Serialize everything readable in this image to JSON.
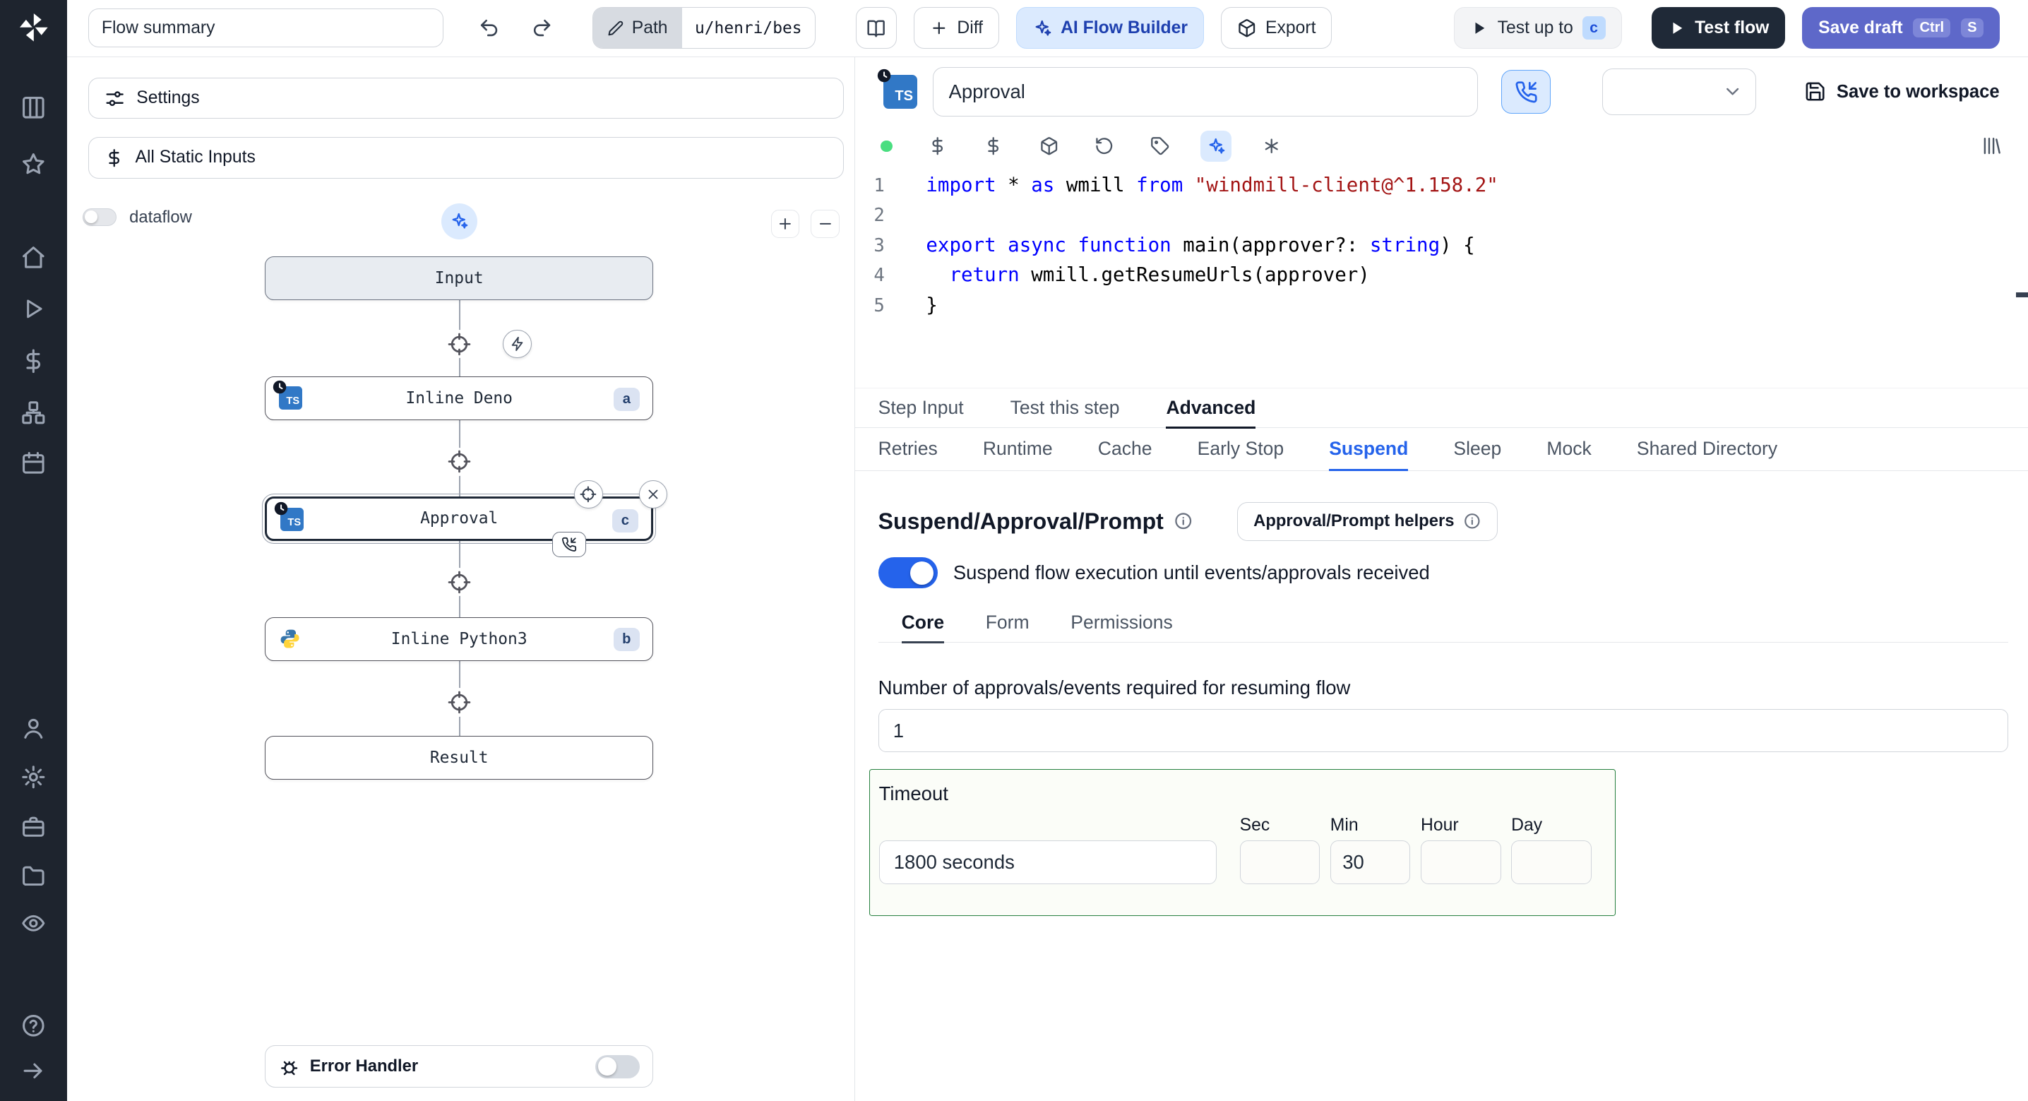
{
  "colors": {
    "sidebar_bg": "#1e242e",
    "accent_blue": "#2563eb",
    "ai_chip_bg": "#dbeafe",
    "test_flow_bg": "#1f2937",
    "save_draft_bg": "#5e68c9",
    "ts_icon_bg": "#3178c6",
    "timeout_border": "#26803f",
    "status_dot": "#4ade80",
    "code_keyword": "#0000ff",
    "code_string": "#a31515",
    "code_plain": "#000000"
  },
  "topbar": {
    "flow_summary_value": "Flow summary",
    "path_label": "Path",
    "path_value": "u/henri/bes",
    "diff_label": "Diff",
    "ai_builder_label": "AI Flow Builder",
    "export_label": "Export",
    "test_up_to_label": "Test up to",
    "test_up_to_badge": "c",
    "test_flow_label": "Test flow",
    "save_draft_label": "Save draft",
    "save_draft_keys": {
      "mod": "Ctrl",
      "key": "S"
    }
  },
  "sidebar": {
    "icons": [
      "windmill-logo",
      "kanban-board",
      "star",
      "home",
      "runs-play",
      "variables-dollar",
      "resources-boxes",
      "schedules-calendar",
      "user",
      "settings-gear",
      "workers-briefcase",
      "folders",
      "audit-eye",
      "help-circle",
      "collapse-arrow"
    ]
  },
  "flow": {
    "settings_label": "Settings",
    "static_inputs_label": "All Static Inputs",
    "dataflow_label": "dataflow",
    "nodes": {
      "input": "Input",
      "deno": {
        "label": "Inline Deno",
        "badge": "a"
      },
      "approval": {
        "label": "Approval",
        "badge": "c"
      },
      "python": {
        "label": "Inline Python3",
        "badge": "b"
      },
      "result": "Result"
    },
    "error_handler_label": "Error Handler"
  },
  "step": {
    "name_value": "Approval",
    "ts_icon_text": "TS",
    "save_to_workspace_label": "Save to workspace"
  },
  "editor": {
    "line_numbers": [
      1,
      2,
      3,
      4,
      5
    ],
    "lines": [
      [
        {
          "t": "import",
          "c": "kw"
        },
        {
          "t": " * ",
          "c": "pl"
        },
        {
          "t": "as",
          "c": "kw"
        },
        {
          "t": " wmill ",
          "c": "pl"
        },
        {
          "t": "from",
          "c": "kw"
        },
        {
          "t": " ",
          "c": "pl"
        },
        {
          "t": "\"windmill-client@^1.158.2\"",
          "c": "str"
        }
      ],
      [],
      [
        {
          "t": "export",
          "c": "kw"
        },
        {
          "t": " ",
          "c": "pl"
        },
        {
          "t": "async",
          "c": "kw"
        },
        {
          "t": " ",
          "c": "pl"
        },
        {
          "t": "function",
          "c": "kw"
        },
        {
          "t": " main(approver?: ",
          "c": "pl"
        },
        {
          "t": "string",
          "c": "kw"
        },
        {
          "t": ") {",
          "c": "pl"
        }
      ],
      [
        {
          "t": "  ",
          "c": "pl"
        },
        {
          "t": "return",
          "c": "kw"
        },
        {
          "t": " wmill.getResumeUrls(approver)",
          "c": "pl"
        }
      ],
      [
        {
          "t": "}",
          "c": "pl"
        }
      ]
    ]
  },
  "tabs": {
    "primary": [
      {
        "label": "Step Input",
        "active": false
      },
      {
        "label": "Test this step",
        "active": false
      },
      {
        "label": "Advanced",
        "active": true
      }
    ],
    "advanced": [
      {
        "label": "Retries",
        "active": false
      },
      {
        "label": "Runtime",
        "active": false
      },
      {
        "label": "Cache",
        "active": false
      },
      {
        "label": "Early Stop",
        "active": false
      },
      {
        "label": "Suspend",
        "active": true
      },
      {
        "label": "Sleep",
        "active": false
      },
      {
        "label": "Mock",
        "active": false
      },
      {
        "label": "Shared Directory",
        "active": false
      }
    ]
  },
  "suspend": {
    "title": "Suspend/Approval/Prompt",
    "helpers_button_label": "Approval/Prompt helpers",
    "toggle_label": "Suspend flow execution until events/approvals received",
    "sub_tabs": [
      {
        "label": "Core",
        "active": true
      },
      {
        "label": "Form",
        "active": false
      },
      {
        "label": "Permissions",
        "active": false
      }
    ],
    "approvals_label": "Number of approvals/events required for resuming flow",
    "approvals_value": "1",
    "timeout": {
      "label": "Timeout",
      "value": "1800 seconds",
      "units": [
        {
          "label": "Sec",
          "value": ""
        },
        {
          "label": "Min",
          "value": "30"
        },
        {
          "label": "Hour",
          "value": ""
        },
        {
          "label": "Day",
          "value": ""
        }
      ]
    }
  }
}
